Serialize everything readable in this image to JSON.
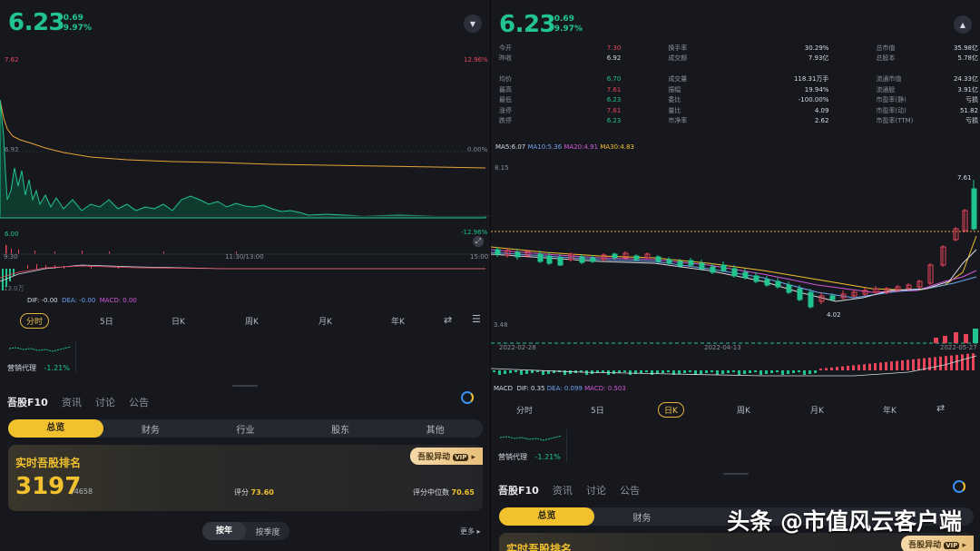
{
  "left": {
    "price": "6.23",
    "change": "-0.69",
    "change_pct": "-9.97%",
    "collapse_icon": "chevron-down-icon",
    "chart": {
      "y_top_label": "7.62",
      "y_mid_label": "6.92",
      "pct_top": "12.96%",
      "pct_mid": "0.00%",
      "pct_bot": "-12.96%",
      "y_bot_label": "6.00",
      "time_start": "9:30",
      "time_mid": "11:30/13:00",
      "time_end": "15:00",
      "vol_label": "13.0万",
      "macd_dif": "DIF: -0.00",
      "macd_dea": "DEA: -0.00",
      "macd_val": "MACD: 0.00"
    },
    "period_tabs": [
      "分时",
      "5日",
      "日K",
      "周K",
      "月K",
      "年K"
    ],
    "sector": {
      "name": "营销代理",
      "pct": "-1.21%"
    },
    "f10_tabs": [
      "吾股F10",
      "资讯",
      "讨论",
      "公告"
    ],
    "seg_tabs": [
      "总览",
      "财务",
      "行业",
      "股东",
      "其他"
    ],
    "rank_card": {
      "title": "实时吾股排名",
      "badge": "吾股异动",
      "vip": "VIP",
      "rank": "3197",
      "total": "/4658",
      "score_label": "评分",
      "score": "73.60",
      "median_label": "评分中位数",
      "median": "70.65"
    },
    "toggle": [
      "按年",
      "按季度"
    ],
    "more": "更多"
  },
  "right": {
    "price": "6.23",
    "change": "-0.69",
    "change_pct": "-9.97%",
    "collapse_icon": "chevron-up-icon",
    "stats": [
      [
        [
          "今开",
          "7.30",
          "red"
        ],
        [
          "换手率",
          "30.29%",
          "wht"
        ],
        [
          "总市值",
          "35.98亿",
          "wht"
        ]
      ],
      [
        [
          "昨收",
          "6.92",
          "wht"
        ],
        [
          "成交额",
          "7.93亿",
          "wht"
        ],
        [
          "总股本",
          "5.78亿",
          "wht"
        ]
      ],
      [
        [
          "",
          "",
          ""
        ],
        [
          "",
          "",
          ""
        ],
        [
          "",
          "",
          ""
        ]
      ],
      [
        [
          "均价",
          "6.70",
          "grn"
        ],
        [
          "成交量",
          "118.31万手",
          "wht"
        ],
        [
          "流通市值",
          "24.33亿",
          "wht"
        ]
      ],
      [
        [
          "最高",
          "7.61",
          "red"
        ],
        [
          "振幅",
          "19.94%",
          "wht"
        ],
        [
          "流通股",
          "3.91亿",
          "wht"
        ]
      ],
      [
        [
          "最低",
          "6.23",
          "grn"
        ],
        [
          "委比",
          "-100.00%",
          "wht"
        ],
        [
          "市盈率(静)",
          "亏损",
          "wht"
        ]
      ],
      [
        [
          "涨停",
          "7.61",
          "red"
        ],
        [
          "量比",
          "4.09",
          "wht"
        ],
        [
          "市盈率(动)",
          "51.82",
          "wht"
        ]
      ],
      [
        [
          "跌停",
          "6.23",
          "grn"
        ],
        [
          "市净率",
          "2.62",
          "wht"
        ],
        [
          "市盈率(TTM)",
          "亏损",
          "wht"
        ]
      ]
    ],
    "ma": {
      "ma5": "MA5:6.07",
      "ma10": "MA10:5.36",
      "ma20": "MA20:4.91",
      "ma30": "MA30:4.83"
    },
    "kline": {
      "y_top": "8.15",
      "y_bot": "3.48",
      "high_label": "7.61",
      "low_label": "4.02",
      "date_start": "2022-02-28",
      "date_mid": "2022-04-13",
      "date_end": "2022-05-27",
      "macd_label": "MACD",
      "macd_dif": "DIF: 0.35",
      "macd_dea": "DEA: 0.099",
      "macd_val": "MACD: 0.503"
    },
    "period_tabs": [
      "分时",
      "5日",
      "日K",
      "周K",
      "月K",
      "年K"
    ],
    "sector": {
      "name": "营销代理",
      "pct": "-1.21%"
    },
    "f10_tabs": [
      "吾股F10",
      "资讯",
      "讨论",
      "公告"
    ],
    "seg_tabs": [
      "总览",
      "财务"
    ],
    "rank_card": {
      "title": "实时吾股排名",
      "badge": "吾股异动",
      "vip": "VIP"
    }
  },
  "watermark": "头条 @市值风云客户端",
  "colors": {
    "green": "#21c48f",
    "red": "#e8455a",
    "gold": "#f2c12e",
    "bg": "#17181e"
  }
}
